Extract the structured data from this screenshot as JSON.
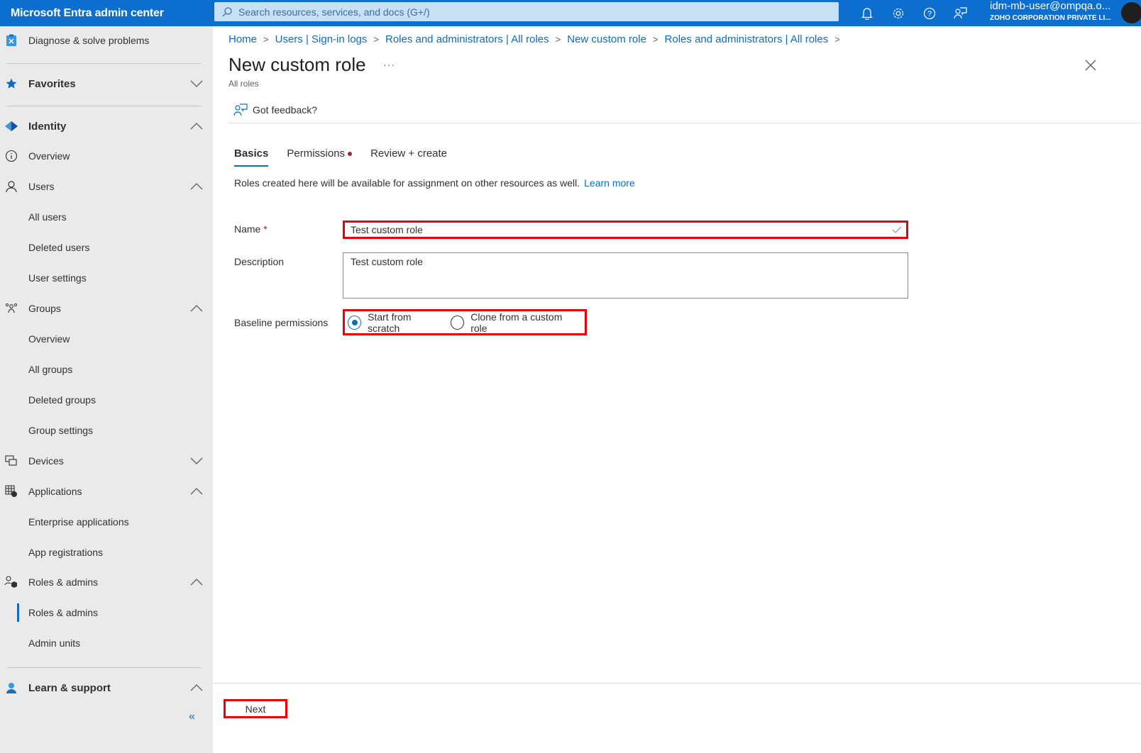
{
  "topbar": {
    "brand": "Microsoft Entra admin center",
    "search_placeholder": "Search resources, services, and docs (G+/)",
    "icons": [
      "bell-icon",
      "gear-icon",
      "help-icon",
      "feedback-icon"
    ],
    "account_user": "idm-mb-user@ompqa.o...",
    "account_org": "ZOHO CORPORATION PRIVATE LI..."
  },
  "sidebar": {
    "items": [
      {
        "label": "Diagnose & solve problems",
        "icon": "diagnose-icon",
        "level": 0
      },
      {
        "label": "Favorites",
        "icon": "star-icon",
        "bold": true,
        "chevron": "down"
      },
      {
        "label": "Identity",
        "icon": "identity-icon",
        "bold": true,
        "chevron": "up"
      },
      {
        "label": "Overview",
        "icon": "info-icon"
      },
      {
        "label": "Users",
        "icon": "user-icon",
        "chevron": "up"
      },
      {
        "label": "All users"
      },
      {
        "label": "Deleted users"
      },
      {
        "label": "User settings"
      },
      {
        "label": "Groups",
        "icon": "groups-icon",
        "chevron": "up"
      },
      {
        "label": "Overview"
      },
      {
        "label": "All groups"
      },
      {
        "label": "Deleted groups"
      },
      {
        "label": "Group settings"
      },
      {
        "label": "Devices",
        "icon": "devices-icon",
        "chevron": "down"
      },
      {
        "label": "Applications",
        "icon": "applications-icon",
        "chevron": "up"
      },
      {
        "label": "Enterprise applications"
      },
      {
        "label": "App registrations"
      },
      {
        "label": "Roles & admins",
        "icon": "roles-icon",
        "chevron": "up"
      },
      {
        "label": "Roles & admins",
        "active": true
      },
      {
        "label": "Admin units"
      },
      {
        "label": "Learn & support",
        "icon": "support-icon",
        "bold": true,
        "chevron": "up"
      }
    ],
    "collapse_glyph": "«"
  },
  "breadcrumb": [
    "Home",
    "Users | Sign-in logs",
    "Roles and administrators | All roles",
    "New custom role",
    "Roles and administrators | All roles"
  ],
  "page": {
    "title": "New custom role",
    "more": "···",
    "subtitle": "All roles",
    "feedback": "Got feedback?"
  },
  "tabs": [
    {
      "label": "Basics",
      "active": true
    },
    {
      "label": "Permissions",
      "has_error_dot": true
    },
    {
      "label": "Review + create"
    }
  ],
  "info": {
    "text": "Roles created here will be available for assignment on other resources as well.",
    "link": "Learn more"
  },
  "form": {
    "name_label": "Name",
    "required_mark": "*",
    "name_value": "Test custom role",
    "description_label": "Description",
    "description_value": "Test custom role",
    "baseline_label": "Baseline permissions",
    "baseline_options": [
      {
        "label": "Start from scratch",
        "selected": true
      },
      {
        "label": "Clone from a custom role",
        "selected": false
      }
    ]
  },
  "footer": {
    "next_label": "Next"
  }
}
